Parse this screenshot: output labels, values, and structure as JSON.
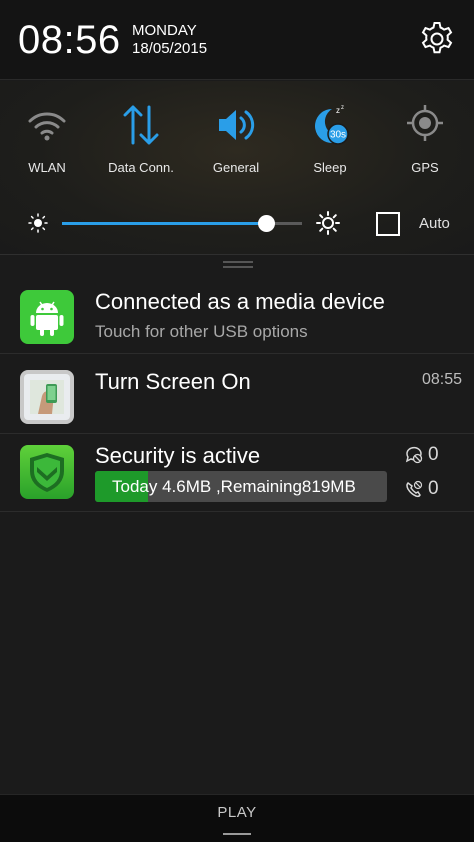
{
  "status": {
    "time": "08:56",
    "day": "MONDAY",
    "date": "18/05/2015"
  },
  "toggles": [
    {
      "label": "WLAN",
      "icon": "wifi-icon",
      "active": false
    },
    {
      "label": "Data Conn.",
      "icon": "data-arrows-icon",
      "active": true
    },
    {
      "label": "General",
      "icon": "volume-icon",
      "active": true
    },
    {
      "label": "Sleep",
      "icon": "sleep-timer-icon",
      "badge": "30s",
      "active": true
    },
    {
      "label": "GPS",
      "icon": "gps-icon",
      "active": false
    }
  ],
  "brightness": {
    "level_fraction": 0.85,
    "auto_label": "Auto",
    "auto_checked": false
  },
  "notifications": [
    {
      "title": "Connected as a media device",
      "subtitle": "Touch for other USB options",
      "icon": "android-icon"
    },
    {
      "title": "Turn Screen On",
      "time": "08:55",
      "icon": "turn-screen-on-app-icon"
    },
    {
      "title": "Security is active",
      "bar_text": "Today 4.6MB ,Remaining819MB",
      "bar_fraction": 0.18,
      "icon": "security-shield-icon",
      "stats": [
        {
          "icon": "blocked-message-icon",
          "value": "0"
        },
        {
          "icon": "blocked-call-icon",
          "value": "0"
        }
      ]
    }
  ],
  "bottom": {
    "label": "PLAY"
  },
  "colors": {
    "accent": "#2a9ee8",
    "security_green": "#1e9a2a",
    "android_green": "#3ec93a",
    "background": "#1b1b1b"
  }
}
